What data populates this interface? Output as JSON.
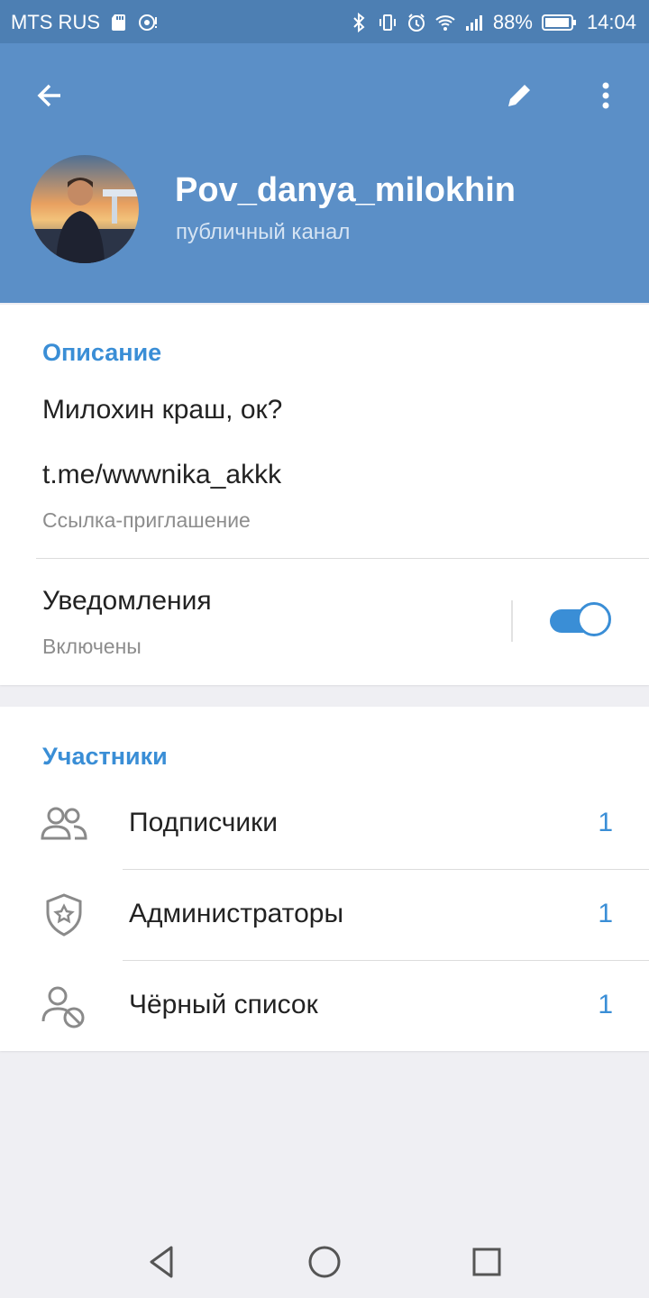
{
  "status_bar": {
    "carrier": "MTS RUS",
    "battery": "88%",
    "time": "14:04"
  },
  "channel": {
    "name": "Pov_danya_milokhin",
    "type": "публичный канал"
  },
  "info": {
    "description_title": "Описание",
    "description_text": "Милохин краш, ок?",
    "link": "t.me/wwwnika_akkk",
    "link_caption": "Ссылка-приглашение",
    "notifications_label": "Уведомления",
    "notifications_status": "Включены",
    "notifications_on": true
  },
  "members": {
    "title": "Участники",
    "rows": [
      {
        "label": "Подписчики",
        "count": "1",
        "icon": "users-icon"
      },
      {
        "label": "Администраторы",
        "count": "1",
        "icon": "admin-shield-icon"
      },
      {
        "label": "Чёрный список",
        "count": "1",
        "icon": "blocked-user-icon"
      }
    ]
  },
  "colors": {
    "header": "#5b8fc7",
    "statusbar": "#4d7fb3",
    "accent": "#3a8ed6"
  }
}
